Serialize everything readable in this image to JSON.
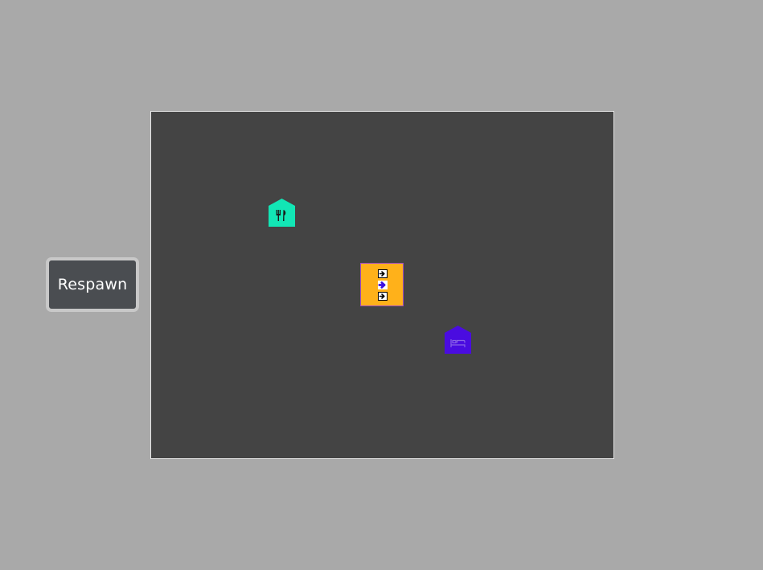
{
  "controls": {
    "respawn_label": "Respawn"
  },
  "board": {
    "background_color": "#444444"
  },
  "buildings": [
    {
      "name": "restaurant",
      "icon": "fork-knife-icon",
      "color": "#12e6b5"
    },
    {
      "name": "home",
      "icon": "bed-icon",
      "color": "#4a0ce0"
    }
  ],
  "player": {
    "color": "#ffb11a",
    "direction_slots": [
      {
        "icon": "arrow-right-icon",
        "active": false
      },
      {
        "icon": "arrow-right-icon",
        "active": true
      },
      {
        "icon": "arrow-right-icon",
        "active": false
      }
    ]
  }
}
